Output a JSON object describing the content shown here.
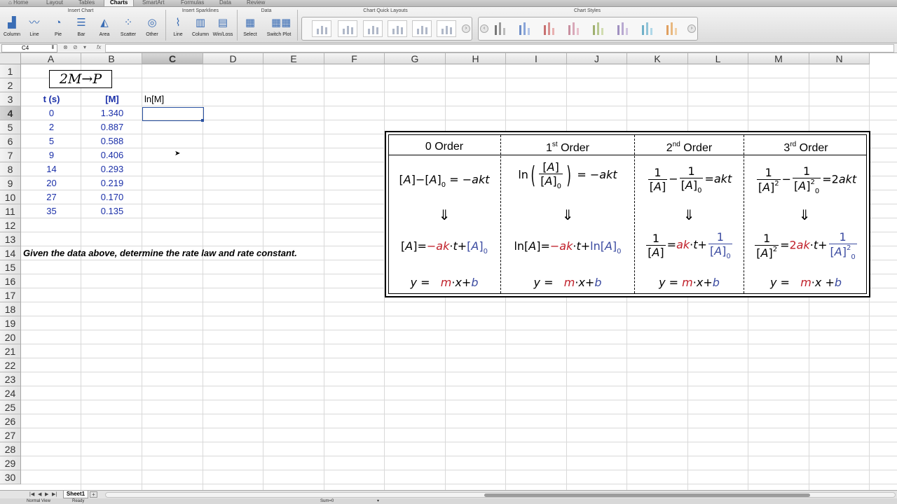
{
  "ribbon": {
    "tabs": [
      "Home",
      "Layout",
      "Tables",
      "Charts",
      "SmartArt",
      "Formulas",
      "Data",
      "Review"
    ],
    "active_tab": "Charts",
    "groups": {
      "insert_chart": "Insert Chart",
      "insert_sparklines": "Insert Sparklines",
      "data": "Data",
      "chart_quick_layouts": "Chart Quick Layouts",
      "chart_styles": "Chart Styles"
    },
    "chart_buttons": [
      {
        "label": "Column",
        "icon": "column-chart-icon"
      },
      {
        "label": "Line",
        "icon": "line-chart-icon"
      },
      {
        "label": "Pie",
        "icon": "pie-chart-icon"
      },
      {
        "label": "Bar",
        "icon": "bar-chart-icon"
      },
      {
        "label": "Area",
        "icon": "area-chart-icon"
      },
      {
        "label": "Scatter",
        "icon": "scatter-chart-icon"
      },
      {
        "label": "Other",
        "icon": "other-chart-icon"
      }
    ],
    "sparkline_buttons": [
      {
        "label": "Line",
        "icon": "sparkline-line-icon"
      },
      {
        "label": "Column",
        "icon": "sparkline-column-icon"
      },
      {
        "label": "Win/Loss",
        "icon": "sparkline-winloss-icon"
      }
    ],
    "data_buttons": [
      {
        "label": "Select",
        "icon": "select-data-icon"
      },
      {
        "label": "Switch Plot",
        "icon": "switch-plot-icon"
      }
    ]
  },
  "formula_bar": {
    "name_box": "C4",
    "fx": "fx",
    "value": ""
  },
  "columns": [
    "A",
    "B",
    "C",
    "D",
    "E",
    "F",
    "G",
    "H",
    "I",
    "J",
    "K",
    "L",
    "M",
    "N"
  ],
  "rows": [
    "1",
    "2",
    "3",
    "4",
    "5",
    "6",
    "7",
    "8",
    "9",
    "10",
    "11",
    "12",
    "13",
    "14",
    "15",
    "16",
    "17",
    "18",
    "19",
    "20",
    "21",
    "22",
    "23",
    "24",
    "25",
    "26",
    "27",
    "28",
    "29",
    "30"
  ],
  "sheet": {
    "reaction": {
      "lhs": "2M",
      "arrow": "→",
      "rhs": "P"
    },
    "headers": {
      "t": "t (s)",
      "M": "[M]",
      "lnM": "ln[M]"
    },
    "t_values": [
      "0",
      "2",
      "5",
      "9",
      "14",
      "20",
      "27",
      "35"
    ],
    "M_values": [
      "1.340",
      "0.887",
      "0.588",
      "0.406",
      "0.293",
      "0.219",
      "0.170",
      "0.135"
    ],
    "question": "Given the data above, determine the rate law and rate constant."
  },
  "orders": {
    "zero": {
      "label": "0 Order"
    },
    "first": {
      "num": "1",
      "sup": "st",
      "label": "Order"
    },
    "second": {
      "num": "2",
      "sup": "nd",
      "label": "Order"
    },
    "third": {
      "num": "3",
      "sup": "rd",
      "label": "Order"
    }
  },
  "sheet_tabs": {
    "active": "Sheet1",
    "add": "+"
  },
  "status": {
    "view": "Normal View",
    "ready": "Ready",
    "sum": "Sum=0"
  }
}
